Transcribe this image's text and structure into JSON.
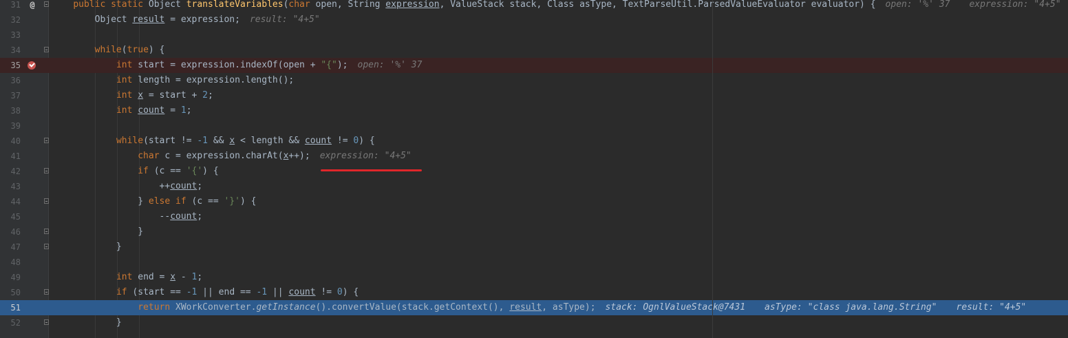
{
  "editor": {
    "lines": [
      {
        "num": "31",
        "marker": "@",
        "tokens": [
          {
            "t": "public static ",
            "c": "kw"
          },
          {
            "t": "Object ",
            "c": ""
          },
          {
            "t": "translateVariables",
            "c": "fn"
          },
          {
            "t": "(",
            "c": ""
          },
          {
            "t": "char ",
            "c": "kw"
          },
          {
            "t": "open, String ",
            "c": ""
          },
          {
            "t": "expression",
            "c": "ul"
          },
          {
            "t": ", ValueStack stack, Class asType, TextParseUtil.ParsedValueEvaluator evaluator) {",
            "c": ""
          }
        ],
        "hints": [
          "open: '%' 37",
          "expression: \"4+5\""
        ]
      },
      {
        "num": "32",
        "tokens": [
          {
            "t": "    Object ",
            "c": ""
          },
          {
            "t": "result",
            "c": "ul"
          },
          {
            "t": " = expression;",
            "c": ""
          }
        ],
        "hints": [
          "result: \"4+5\""
        ]
      },
      {
        "num": "33",
        "tokens": []
      },
      {
        "num": "34",
        "tokens": [
          {
            "t": "    ",
            "c": ""
          },
          {
            "t": "while",
            "c": "kw"
          },
          {
            "t": "(",
            "c": ""
          },
          {
            "t": "true",
            "c": "kw"
          },
          {
            "t": ") {",
            "c": ""
          }
        ]
      },
      {
        "num": "35",
        "breakpoint": true,
        "tokens": [
          {
            "t": "        ",
            "c": ""
          },
          {
            "t": "int ",
            "c": "kw"
          },
          {
            "t": "start = expression.indexOf(open + ",
            "c": ""
          },
          {
            "t": "\"{\"",
            "c": "str"
          },
          {
            "t": ");",
            "c": ""
          }
        ],
        "hints": [
          "open: '%' 37"
        ]
      },
      {
        "num": "36",
        "tokens": [
          {
            "t": "        ",
            "c": ""
          },
          {
            "t": "int ",
            "c": "kw"
          },
          {
            "t": "length = expression.length();",
            "c": ""
          }
        ]
      },
      {
        "num": "37",
        "tokens": [
          {
            "t": "        ",
            "c": ""
          },
          {
            "t": "int ",
            "c": "kw"
          },
          {
            "t": "x",
            "c": "ul"
          },
          {
            "t": " = start + ",
            "c": ""
          },
          {
            "t": "2",
            "c": "num"
          },
          {
            "t": ";",
            "c": ""
          }
        ]
      },
      {
        "num": "38",
        "tokens": [
          {
            "t": "        ",
            "c": ""
          },
          {
            "t": "int ",
            "c": "kw"
          },
          {
            "t": "count",
            "c": "ul"
          },
          {
            "t": " = ",
            "c": ""
          },
          {
            "t": "1",
            "c": "num"
          },
          {
            "t": ";",
            "c": ""
          }
        ]
      },
      {
        "num": "39",
        "tokens": []
      },
      {
        "num": "40",
        "tokens": [
          {
            "t": "        ",
            "c": ""
          },
          {
            "t": "while",
            "c": "kw"
          },
          {
            "t": "(start != ",
            "c": ""
          },
          {
            "t": "-1",
            "c": "num"
          },
          {
            "t": " && ",
            "c": ""
          },
          {
            "t": "x",
            "c": "ul"
          },
          {
            "t": " < length && ",
            "c": ""
          },
          {
            "t": "count",
            "c": "ul"
          },
          {
            "t": " != ",
            "c": ""
          },
          {
            "t": "0",
            "c": "num"
          },
          {
            "t": ") {",
            "c": ""
          }
        ]
      },
      {
        "num": "41",
        "tokens": [
          {
            "t": "            ",
            "c": ""
          },
          {
            "t": "char ",
            "c": "kw"
          },
          {
            "t": "c = expression.charAt(",
            "c": ""
          },
          {
            "t": "x",
            "c": "ul"
          },
          {
            "t": "++);",
            "c": ""
          }
        ],
        "hints": [
          "expression: \"4+5\""
        ]
      },
      {
        "num": "42",
        "tokens": [
          {
            "t": "            ",
            "c": ""
          },
          {
            "t": "if ",
            "c": "kw"
          },
          {
            "t": "(c == ",
            "c": ""
          },
          {
            "t": "'{'",
            "c": "str"
          },
          {
            "t": ") {",
            "c": ""
          }
        ]
      },
      {
        "num": "43",
        "tokens": [
          {
            "t": "                ++",
            "c": ""
          },
          {
            "t": "count",
            "c": "ul"
          },
          {
            "t": ";",
            "c": ""
          }
        ]
      },
      {
        "num": "44",
        "tokens": [
          {
            "t": "            } ",
            "c": ""
          },
          {
            "t": "else if ",
            "c": "kw"
          },
          {
            "t": "(c == ",
            "c": ""
          },
          {
            "t": "'}'",
            "c": "str"
          },
          {
            "t": ") {",
            "c": ""
          }
        ]
      },
      {
        "num": "45",
        "tokens": [
          {
            "t": "                --",
            "c": ""
          },
          {
            "t": "count",
            "c": "ul"
          },
          {
            "t": ";",
            "c": ""
          }
        ]
      },
      {
        "num": "46",
        "tokens": [
          {
            "t": "            }",
            "c": ""
          }
        ]
      },
      {
        "num": "47",
        "tokens": [
          {
            "t": "        }",
            "c": ""
          }
        ]
      },
      {
        "num": "48",
        "tokens": []
      },
      {
        "num": "49",
        "tokens": [
          {
            "t": "        ",
            "c": ""
          },
          {
            "t": "int ",
            "c": "kw"
          },
          {
            "t": "end = ",
            "c": ""
          },
          {
            "t": "x",
            "c": "ul"
          },
          {
            "t": " - ",
            "c": ""
          },
          {
            "t": "1",
            "c": "num"
          },
          {
            "t": ";",
            "c": ""
          }
        ]
      },
      {
        "num": "50",
        "tokens": [
          {
            "t": "        ",
            "c": ""
          },
          {
            "t": "if ",
            "c": "kw"
          },
          {
            "t": "(start == ",
            "c": ""
          },
          {
            "t": "-1",
            "c": "num"
          },
          {
            "t": " || end == ",
            "c": ""
          },
          {
            "t": "-1",
            "c": "num"
          },
          {
            "t": " || ",
            "c": ""
          },
          {
            "t": "count",
            "c": "ul"
          },
          {
            "t": " != ",
            "c": ""
          },
          {
            "t": "0",
            "c": "num"
          },
          {
            "t": ") {",
            "c": ""
          }
        ]
      },
      {
        "num": "51",
        "current": true,
        "tokens": [
          {
            "t": "            ",
            "c": ""
          },
          {
            "t": "return ",
            "c": "kw"
          },
          {
            "t": "XWorkConverter.",
            "c": ""
          },
          {
            "t": "getInstance",
            "c": "ital"
          },
          {
            "t": "().convertValue(stack.getContext(), ",
            "c": ""
          },
          {
            "t": "result",
            "c": "ul"
          },
          {
            "t": ", asType);",
            "c": ""
          }
        ],
        "hints": [
          "stack: OgnlValueStack@7431",
          "asType: \"class java.lang.String\"",
          "result: \"4+5\""
        ]
      },
      {
        "num": "52",
        "tokens": [
          {
            "t": "        }",
            "c": ""
          }
        ]
      }
    ],
    "fold_lines": [
      "31",
      "34",
      "40",
      "42",
      "44",
      "46",
      "47",
      "50",
      "52"
    ]
  },
  "colors": {
    "background": "#2b2b2b",
    "gutter": "#313335",
    "keyword": "#cc7832",
    "function": "#ffc66d",
    "string": "#6a8759",
    "number": "#6897bb",
    "current_line": "#2d5b8e",
    "breakpoint_line": "#3a2323",
    "annotation_underline": "#e0262a"
  }
}
